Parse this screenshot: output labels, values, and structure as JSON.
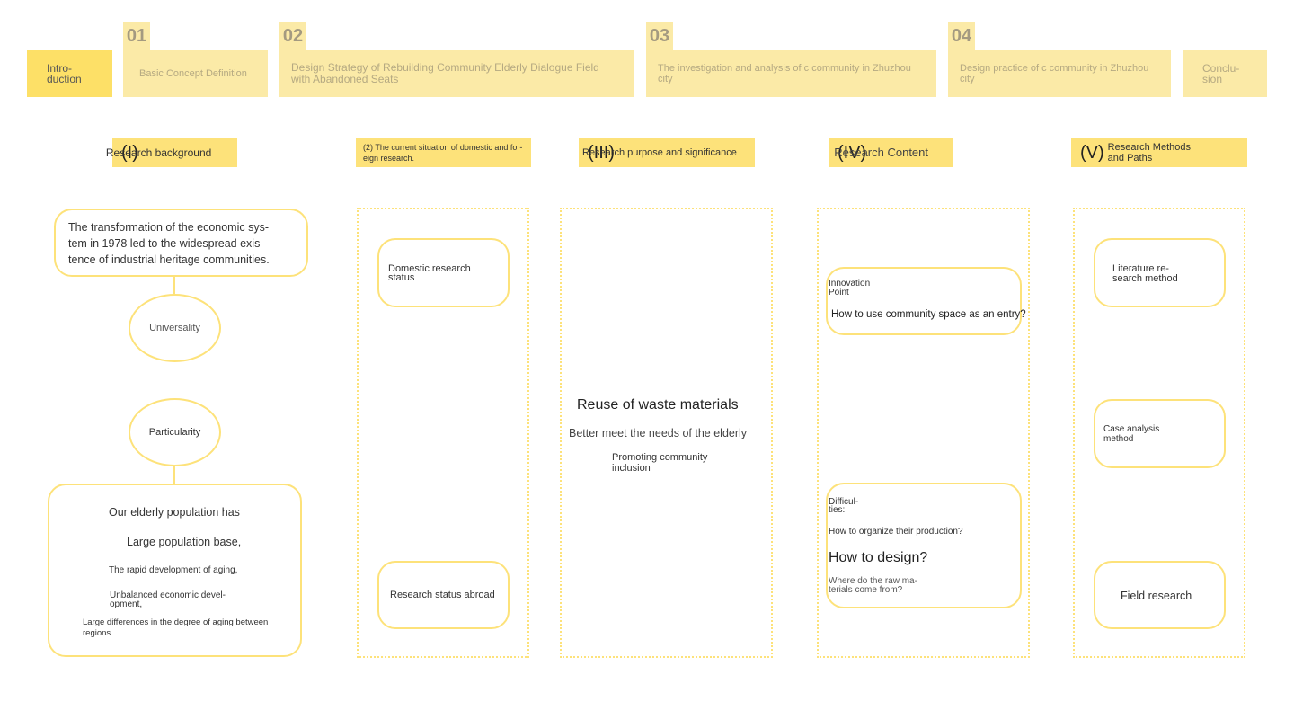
{
  "nav": {
    "intro": "Intro-\nduction",
    "items": [
      {
        "num": "01",
        "label": "Basic Concept Definition"
      },
      {
        "num": "02",
        "label": "Design Strategy of Rebuilding Community Elderly Dialogue Field with Abandoned Seats"
      },
      {
        "num": "03",
        "label": "The investigation and analysis of c community in Zhuzhou city"
      },
      {
        "num": "04",
        "label": "Design practice of c community in Zhuzhou city"
      }
    ],
    "conclusion": "Conclu-\nsion"
  },
  "sections": {
    "s1": {
      "roman": "(I)",
      "label": "Research background"
    },
    "s2": {
      "label": "(2) The current situation of domestic and for-\neign research."
    },
    "s3": {
      "roman": "(III)",
      "label": "Research purpose and significance"
    },
    "s4": {
      "roman": "(IV)",
      "label": "Research Content"
    },
    "s5": {
      "roman": "(V)",
      "label": "Research Methods and Paths"
    }
  },
  "col1": {
    "top_box": "The transformation of the economic sys-\ntem in 1978 led to the widespread exis-\ntence of industrial heritage communities.",
    "circle1": "Universality",
    "circle2": "Particularity",
    "line1": "Our elderly population has",
    "line2": "Large population base,",
    "line3": "The rapid development of aging,",
    "line4": "Unbalanced economic devel-\nopment,",
    "line5": "Large differences in the degree of aging between\nregions"
  },
  "col2": {
    "box1": "Domestic research\nstatus",
    "box2": "Research status abroad"
  },
  "col3": {
    "line1": "Reuse of waste materials",
    "line2": "Better meet the needs of the elderly",
    "line3": "Promoting community\ninclusion"
  },
  "col4": {
    "innov_label": "Innovation\nPoint",
    "innov_text": "How to use community space as an entry?",
    "diff_label": "Difficul-\nties:",
    "diff_q1": "How to organize their production?",
    "diff_q2": "How to design?",
    "diff_q3": "Where do the raw ma-\nterials come from?"
  },
  "col5": {
    "box1": "Literature re-\nsearch method",
    "box2": "Case analysis\nmethod",
    "box3": "Field research"
  }
}
